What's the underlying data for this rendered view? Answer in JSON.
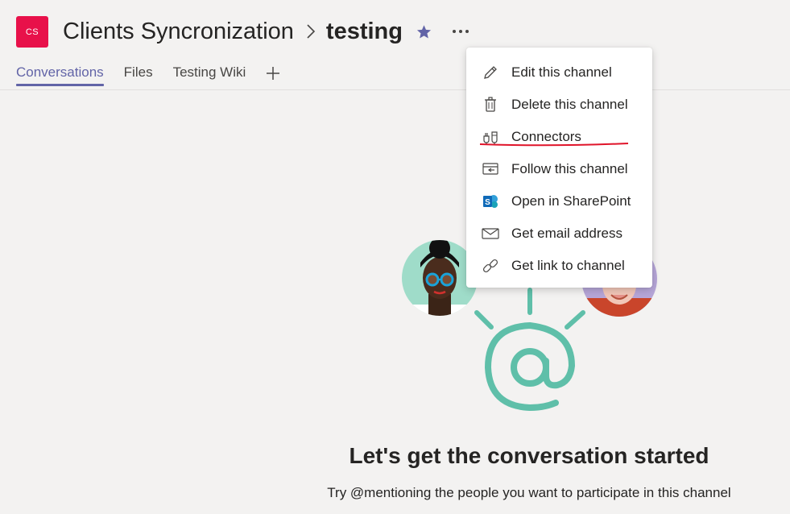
{
  "theme": {
    "accent": "#6264a7",
    "team_avatar_color": "#e8114a",
    "underline_annotation_color": "#e0142a",
    "illustration_color": "#5fbfa9"
  },
  "header": {
    "team_avatar_initials": "CS",
    "team_name": "Clients Syncronization",
    "breadcrumb_separator_icon": "chevron-right-icon",
    "channel_name": "testing",
    "favorite_icon": "star-icon",
    "more_icon": "ellipsis-icon"
  },
  "tabs": [
    {
      "label": "Conversations",
      "active": true
    },
    {
      "label": "Files",
      "active": false
    },
    {
      "label": "Testing Wiki",
      "active": false
    }
  ],
  "add_tab_icon": "plus-icon",
  "channel_menu": {
    "items": [
      {
        "label": "Edit this channel",
        "icon": "pencil-icon"
      },
      {
        "label": "Delete this channel",
        "icon": "trash-icon"
      },
      {
        "label": "Connectors",
        "icon": "connectors-icon",
        "annotated": true
      },
      {
        "label": "Follow this channel",
        "icon": "follow-icon"
      },
      {
        "label": "Open in SharePoint",
        "icon": "sharepoint-icon"
      },
      {
        "label": "Get email address",
        "icon": "mail-icon"
      },
      {
        "label": "Get link to channel",
        "icon": "link-icon"
      }
    ]
  },
  "empty_state": {
    "title": "Let's get the conversation started",
    "subtitle": "Try @mentioning the people you want to participate in this channel"
  }
}
